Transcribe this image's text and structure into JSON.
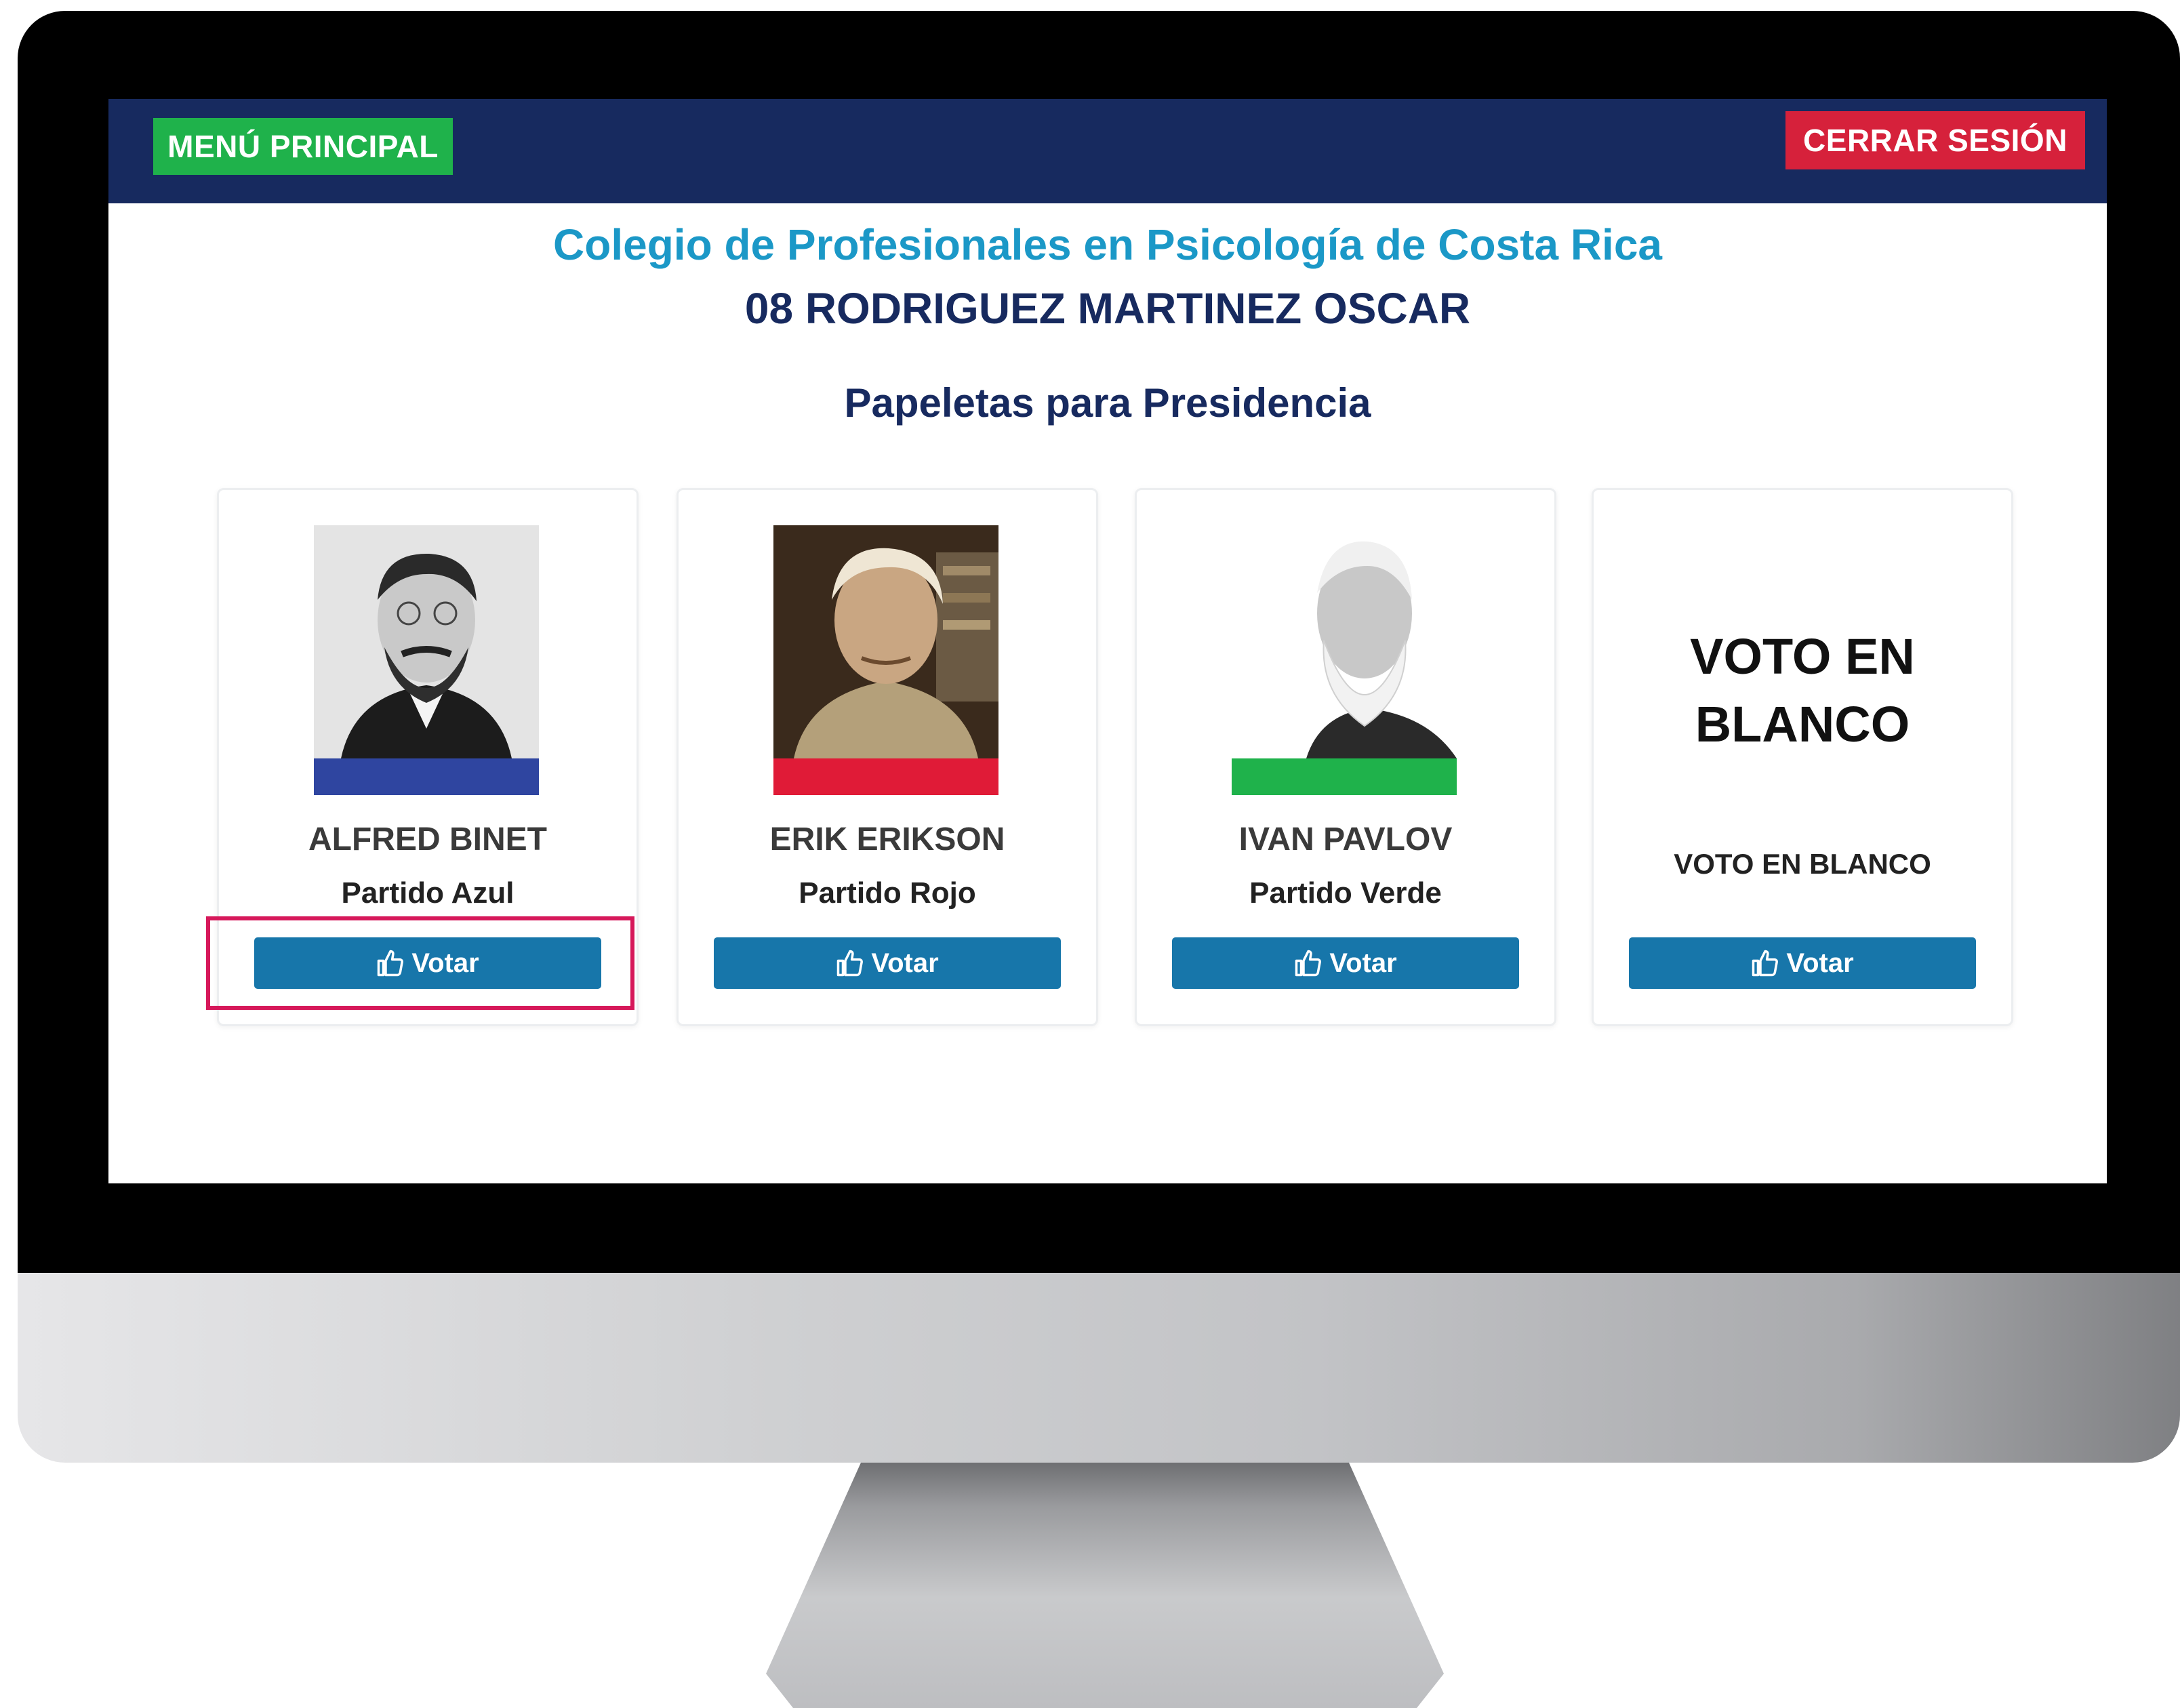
{
  "header": {
    "menu_label": "MENÚ PRINCIPAL",
    "logout_label": "CERRAR SESIÓN"
  },
  "main": {
    "org_title": "Colegio de Profesionales en Psicología de Costa Rica",
    "voter_name": "08 RODRIGUEZ MARTINEZ OSCAR",
    "ballot_title": "Papeletas para Presidencia"
  },
  "candidates": [
    {
      "name": "ALFRED BINET",
      "party": "Partido Azul",
      "party_color": "#2f45a0",
      "vote_label": "Votar",
      "icon": "thumbs-up-icon"
    },
    {
      "name": "ERIK ERIKSON",
      "party": "Partido Rojo",
      "party_color": "#e01b37",
      "vote_label": "Votar",
      "icon": "thumbs-up-icon"
    },
    {
      "name": "IVAN PAVLOV",
      "party": "Partido Verde",
      "party_color": "#1fb24b",
      "vote_label": "Votar",
      "icon": "thumbs-up-icon"
    }
  ],
  "blank_vote": {
    "title_line1": "VOTO EN",
    "title_line2": "BLANCO",
    "subtitle": "VOTO EN BLANCO",
    "vote_label": "Votar",
    "icon": "thumbs-up-icon"
  },
  "colors": {
    "navbar": "#172a5f",
    "menu_button": "#1fb24b",
    "logout_button": "#d6213b",
    "org_title": "#1b98c7",
    "vote_button": "#1776aa",
    "highlight": "#d6185a"
  }
}
